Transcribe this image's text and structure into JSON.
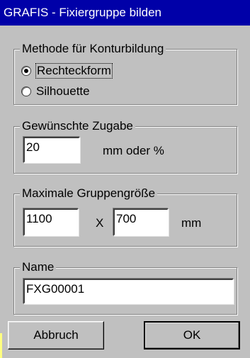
{
  "window": {
    "title": "GRAFIS - Fixiergruppe bilden"
  },
  "method_group": {
    "legend": "Methode für Konturbildung",
    "options": [
      {
        "label": "Rechteckform",
        "selected": true
      },
      {
        "label": "Silhouette",
        "selected": false
      }
    ]
  },
  "allowance_group": {
    "legend": "Gewünschte Zugabe",
    "value": "20",
    "unit_label": "mm oder %"
  },
  "max_size_group": {
    "legend": "Maximale Gruppengröße",
    "width_value": "1100",
    "separator": "X",
    "height_value": "700",
    "unit_label": "mm"
  },
  "name_group": {
    "legend": "Name",
    "value": "FXG00001"
  },
  "buttons": {
    "cancel_label": "Abbruch",
    "ok_label": "OK"
  }
}
